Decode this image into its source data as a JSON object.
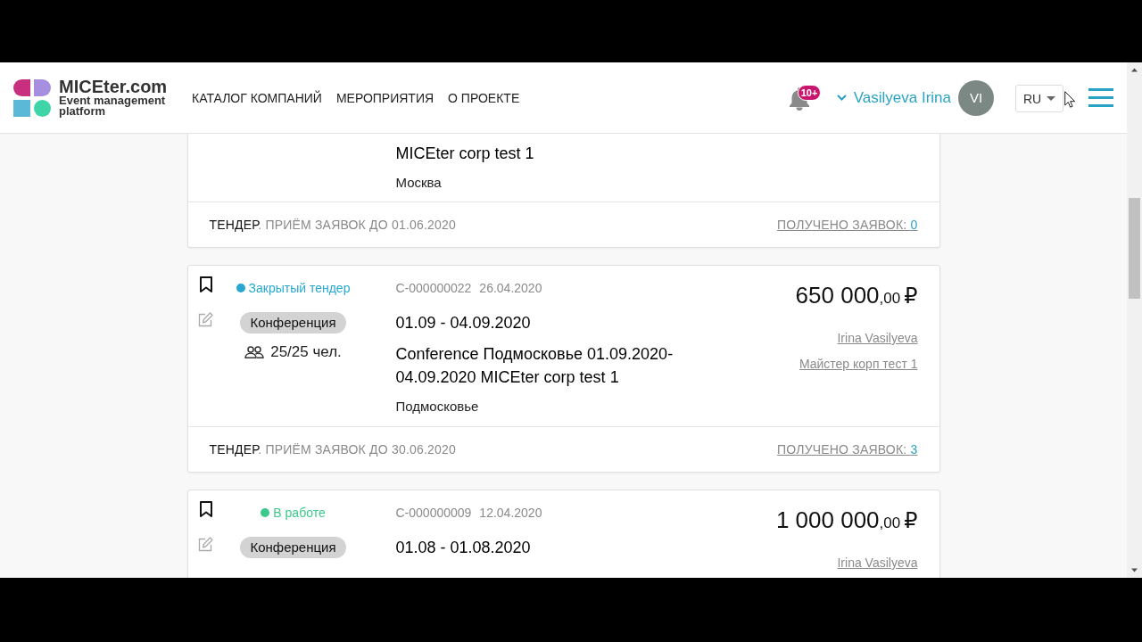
{
  "header": {
    "brand": "MICEter.com",
    "tagline": "Event management platform",
    "nav": [
      "КАТАЛОГ КОМПАНИЙ",
      "МЕРОПРИЯТИЯ",
      "О ПРОЕКТЕ"
    ],
    "notifications_badge": "10+",
    "user_name": "Vasilyeva Irina",
    "avatar_initials": "VI",
    "language": "RU"
  },
  "cards": [
    {
      "title": "MICEter corp test 1",
      "location": "Москва",
      "footer": {
        "tender": "**ТЕНДЕР**. ПРИЁМ ЗАЯВОК ДО 01.06.2020",
        "applications_label": "ПОЛУЧЕНО ЗАЯВОК:",
        "applications_count": "0"
      }
    },
    {
      "bookmarked": false,
      "status": {
        "label": "Закрытый тендер",
        "color": "#26a8d0"
      },
      "category": "Конференция",
      "participants": "25/25 чел.",
      "code": "C-000000022",
      "created": "26.04.2020",
      "dates": "01.09 - 04.09.2020",
      "title": "Conference Подмосковье 01.09.2020-04.09.2020 MICEter corp test 1",
      "location": "Подмосковье",
      "price": {
        "amount": "650 000",
        "cents": ",00",
        "currency": "₽"
      },
      "links": [
        "Irina Vasilyeva",
        "Майстер корп тест 1"
      ],
      "footer": {
        "tender": "**ТЕНДЕР**. ПРИЁМ ЗАЯВОК ДО 30.06.2020",
        "applications_label": "ПОЛУЧЕНО ЗАЯВОК:",
        "applications_count": "3"
      }
    },
    {
      "bookmarked": false,
      "status": {
        "label": "В работе",
        "color": "#3cc98b"
      },
      "category": "Конференция",
      "code": "C-000000009",
      "created": "12.04.2020",
      "dates": "01.08 - 01.08.2020",
      "price": {
        "amount": "1 000 000",
        "cents": ",00",
        "currency": "₽"
      },
      "links": [
        "Irina Vasilyeva"
      ]
    }
  ]
}
